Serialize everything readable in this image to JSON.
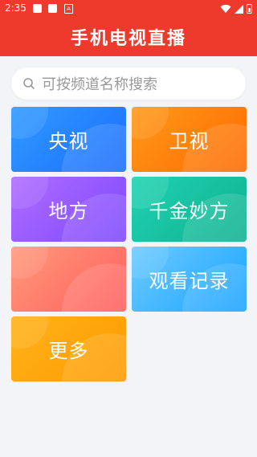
{
  "status_bar": {
    "time": "2:35",
    "icon_a": "A"
  },
  "header": {
    "title": "手机电视直播",
    "bg_color": "#ee3a2c"
  },
  "search": {
    "placeholder": "可按频道名称搜索",
    "value": ""
  },
  "tiles": [
    {
      "label": "央视",
      "color": "#1c6dff"
    },
    {
      "label": "卫视",
      "color": "#ff6a00"
    },
    {
      "label": "地方",
      "color": "#7d49ff"
    },
    {
      "label": "千金妙方",
      "color": "#10b08f"
    },
    {
      "label": "",
      "color": "#ff5f5f"
    },
    {
      "label": "观看记录",
      "color": "#1ba3ff"
    },
    {
      "label": "更多",
      "color": "#ff9a00"
    }
  ]
}
